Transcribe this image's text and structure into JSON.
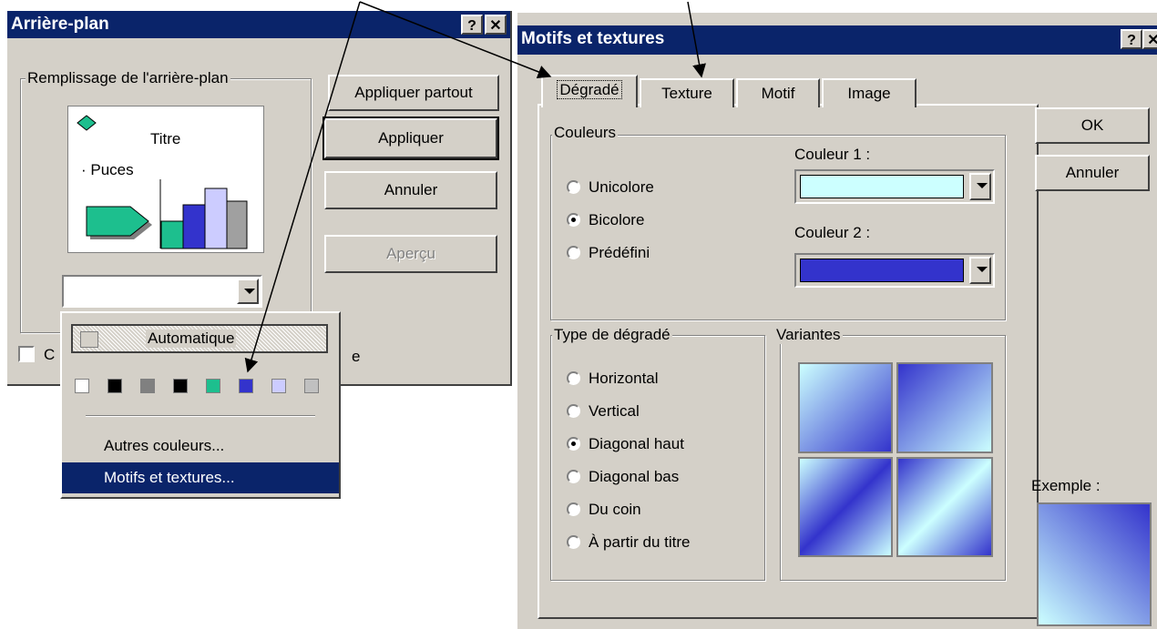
{
  "background_dialog": {
    "title": "Arrière-plan",
    "help_button": "?",
    "close_button": "✕",
    "fill_group": "Remplissage de l'arrière-plan",
    "preview": {
      "title": "Titre",
      "bullet": "Puces"
    },
    "buttons": {
      "apply_all": "Appliquer partout",
      "apply": "Appliquer",
      "cancel": "Annuler",
      "preview": "Aperçu"
    },
    "checkbox_fragment_left": "C",
    "checkbox_fragment_right": "e"
  },
  "color_menu": {
    "automatic": "Automatique",
    "swatches": [
      "#ffffff",
      "#000000",
      "#808080",
      "#000000",
      "#1dbf8e",
      "#3333cc",
      "#ccccff",
      "#c0c0c0"
    ],
    "more_colors": "Autres couleurs...",
    "patterns": "Motifs et textures..."
  },
  "patterns_dialog": {
    "title": "Motifs et textures",
    "help_button": "?",
    "close_button": "✕",
    "tabs": [
      "Dégradé",
      "Texture",
      "Motif",
      "Image"
    ],
    "colors_group": "Couleurs",
    "color_options": [
      "Unicolore",
      "Bicolore",
      "Prédéfini"
    ],
    "color_selected": "Bicolore",
    "color1_label": "Couleur 1 :",
    "color2_label": "Couleur 2 :",
    "color1_value": "#ccffff",
    "color2_value": "#3333cc",
    "gradient_type_group": "Type de dégradé",
    "gradient_types": [
      "Horizontal",
      "Vertical",
      "Diagonal haut",
      "Diagonal bas",
      "Du coin",
      "À partir du titre"
    ],
    "gradient_selected": "Diagonal haut",
    "variants_group": "Variantes",
    "ok_button": "OK",
    "cancel_button": "Annuler",
    "example_label": "Exemple :"
  }
}
